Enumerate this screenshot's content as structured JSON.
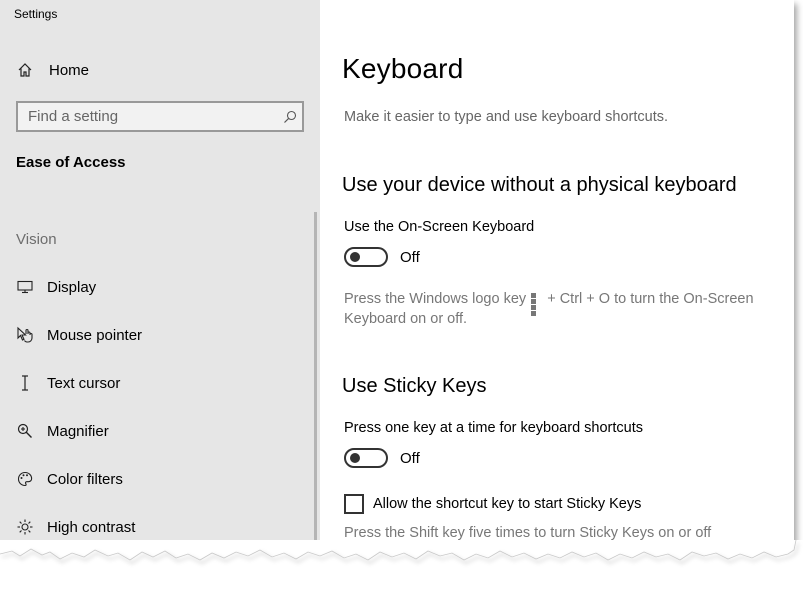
{
  "app": {
    "title": "Settings"
  },
  "sidebar": {
    "home_label": "Home",
    "search_placeholder": "Find a setting",
    "section_title": "Ease of Access",
    "group_label": "Vision",
    "items": [
      {
        "label": "Display",
        "icon": "monitor-icon"
      },
      {
        "label": "Mouse pointer",
        "icon": "mouse-pointer-icon"
      },
      {
        "label": "Text cursor",
        "icon": "text-cursor-icon"
      },
      {
        "label": "Magnifier",
        "icon": "magnifier-icon"
      },
      {
        "label": "Color filters",
        "icon": "palette-icon"
      },
      {
        "label": "High contrast",
        "icon": "sun-icon"
      }
    ]
  },
  "main": {
    "title": "Keyboard",
    "description": "Make it easier to type and use keyboard shortcuts.",
    "sections": [
      {
        "heading": "Use your device without a physical keyboard",
        "setting_label": "Use the On-Screen Keyboard",
        "toggle_state": "Off",
        "help_before": "Press the Windows logo key",
        "help_after": "+ Ctrl + O to turn the On-Screen Keyboard on or off."
      },
      {
        "heading": "Use Sticky Keys",
        "setting_label": "Press one key at a time for keyboard shortcuts",
        "toggle_state": "Off",
        "checkbox_label": "Allow the shortcut key to start Sticky Keys",
        "help_text": "Press the Shift key five times to turn Sticky Keys on or off"
      }
    ]
  },
  "colors": {
    "sidebar_bg": "#e6e6e6",
    "muted_text": "#777777",
    "toggle_border": "#333333"
  }
}
